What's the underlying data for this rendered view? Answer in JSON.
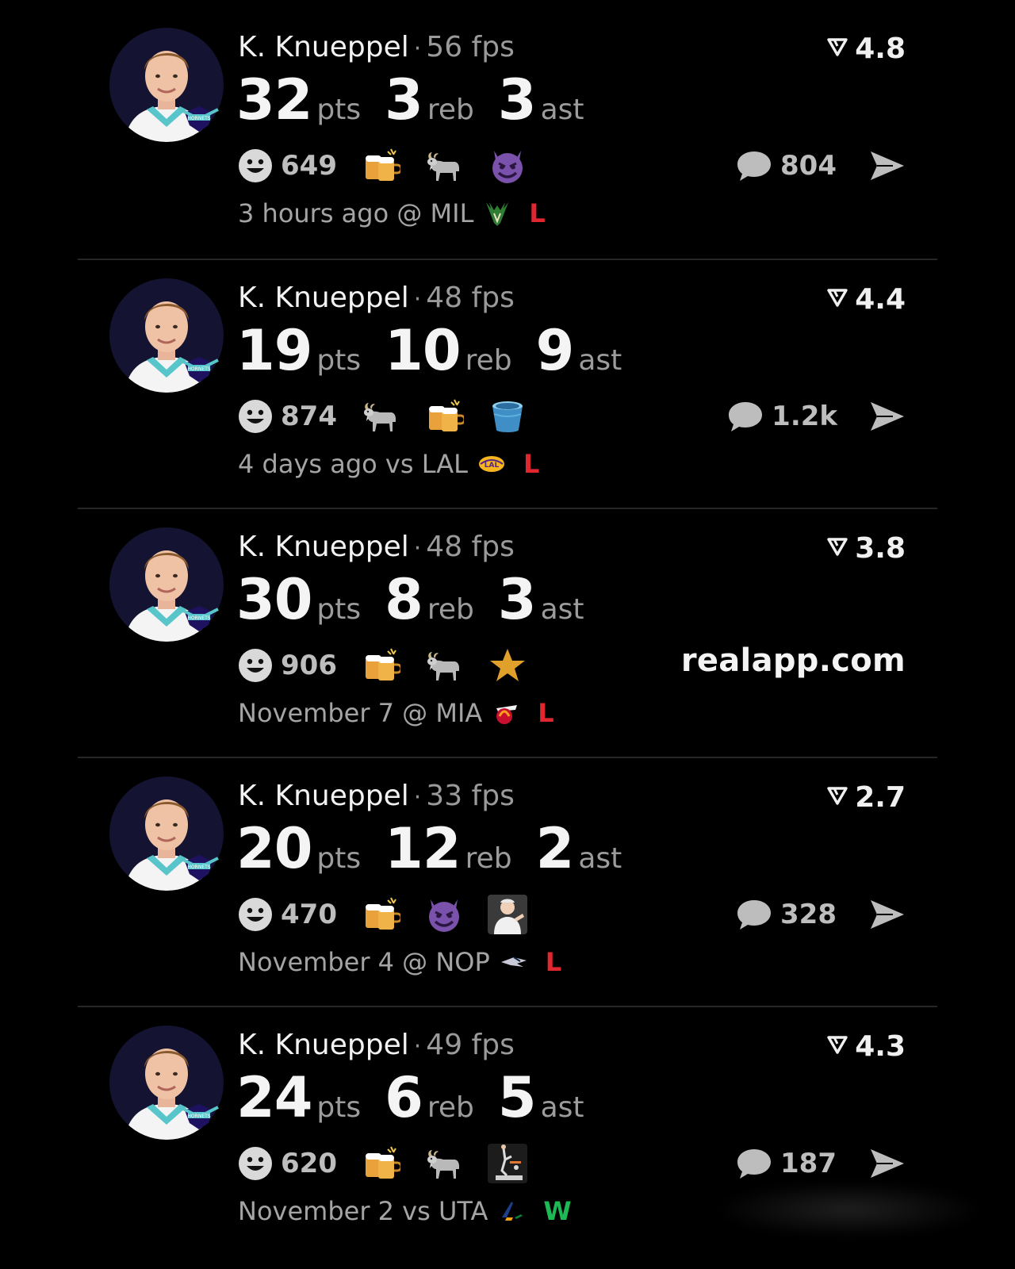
{
  "posts": [
    {
      "player": "K. Knueppel",
      "fps": "56 fps",
      "rating": "4.8",
      "stats": [
        {
          "value": "32",
          "label": "pts"
        },
        {
          "value": "3",
          "label": "reb"
        },
        {
          "value": "3",
          "label": "ast"
        }
      ],
      "reaction_count": "649",
      "reactions": [
        "beer-icon",
        "goat-icon",
        "devil-icon"
      ],
      "comment_count": "804",
      "when": "3 hours ago @ MIL",
      "opponent_logo": "bucks-logo-icon",
      "result": "L"
    },
    {
      "player": "K. Knueppel",
      "fps": "48 fps",
      "rating": "4.4",
      "stats": [
        {
          "value": "19",
          "label": "pts"
        },
        {
          "value": "10",
          "label": "reb"
        },
        {
          "value": "9",
          "label": "ast"
        }
      ],
      "reaction_count": "874",
      "reactions": [
        "goat-icon",
        "beer-icon",
        "bucket-icon"
      ],
      "comment_count": "1.2k",
      "when": "4 days ago vs LAL",
      "opponent_logo": "lakers-logo-icon",
      "result": "L"
    },
    {
      "player": "K. Knueppel",
      "fps": "48 fps",
      "rating": "3.8",
      "stats": [
        {
          "value": "30",
          "label": "pts"
        },
        {
          "value": "8",
          "label": "reb"
        },
        {
          "value": "3",
          "label": "ast"
        }
      ],
      "reaction_count": "906",
      "reactions": [
        "beer-icon",
        "goat-icon",
        "star-icon"
      ],
      "watermark": "realapp.com",
      "when": "November 7 @ MIA",
      "opponent_logo": "heat-logo-icon",
      "result": "L"
    },
    {
      "player": "K. Knueppel",
      "fps": "33 fps",
      "rating": "2.7",
      "stats": [
        {
          "value": "20",
          "label": "pts"
        },
        {
          "value": "12",
          "label": "reb"
        },
        {
          "value": "2",
          "label": "ast"
        }
      ],
      "reaction_count": "470",
      "reactions": [
        "beer-icon",
        "devil-icon",
        "meme-icon"
      ],
      "comment_count": "328",
      "when": "November 4 @ NOP",
      "opponent_logo": "pelicans-logo-icon",
      "result": "L"
    },
    {
      "player": "K. Knueppel",
      "fps": "49 fps",
      "rating": "4.3",
      "stats": [
        {
          "value": "24",
          "label": "pts"
        },
        {
          "value": "6",
          "label": "reb"
        },
        {
          "value": "5",
          "label": "ast"
        }
      ],
      "reaction_count": "620",
      "reactions": [
        "beer-icon",
        "goat-icon",
        "dunk-icon"
      ],
      "comment_count": "187",
      "when": "November 2 vs UTA",
      "opponent_logo": "jazz-logo-icon",
      "result": "W"
    }
  ],
  "colors": {
    "background": "#000000",
    "loss": "#e0262e",
    "win": "#1db954",
    "avatar_bg": "#1a1a2e",
    "jersey_teal": "#57c5c9"
  }
}
